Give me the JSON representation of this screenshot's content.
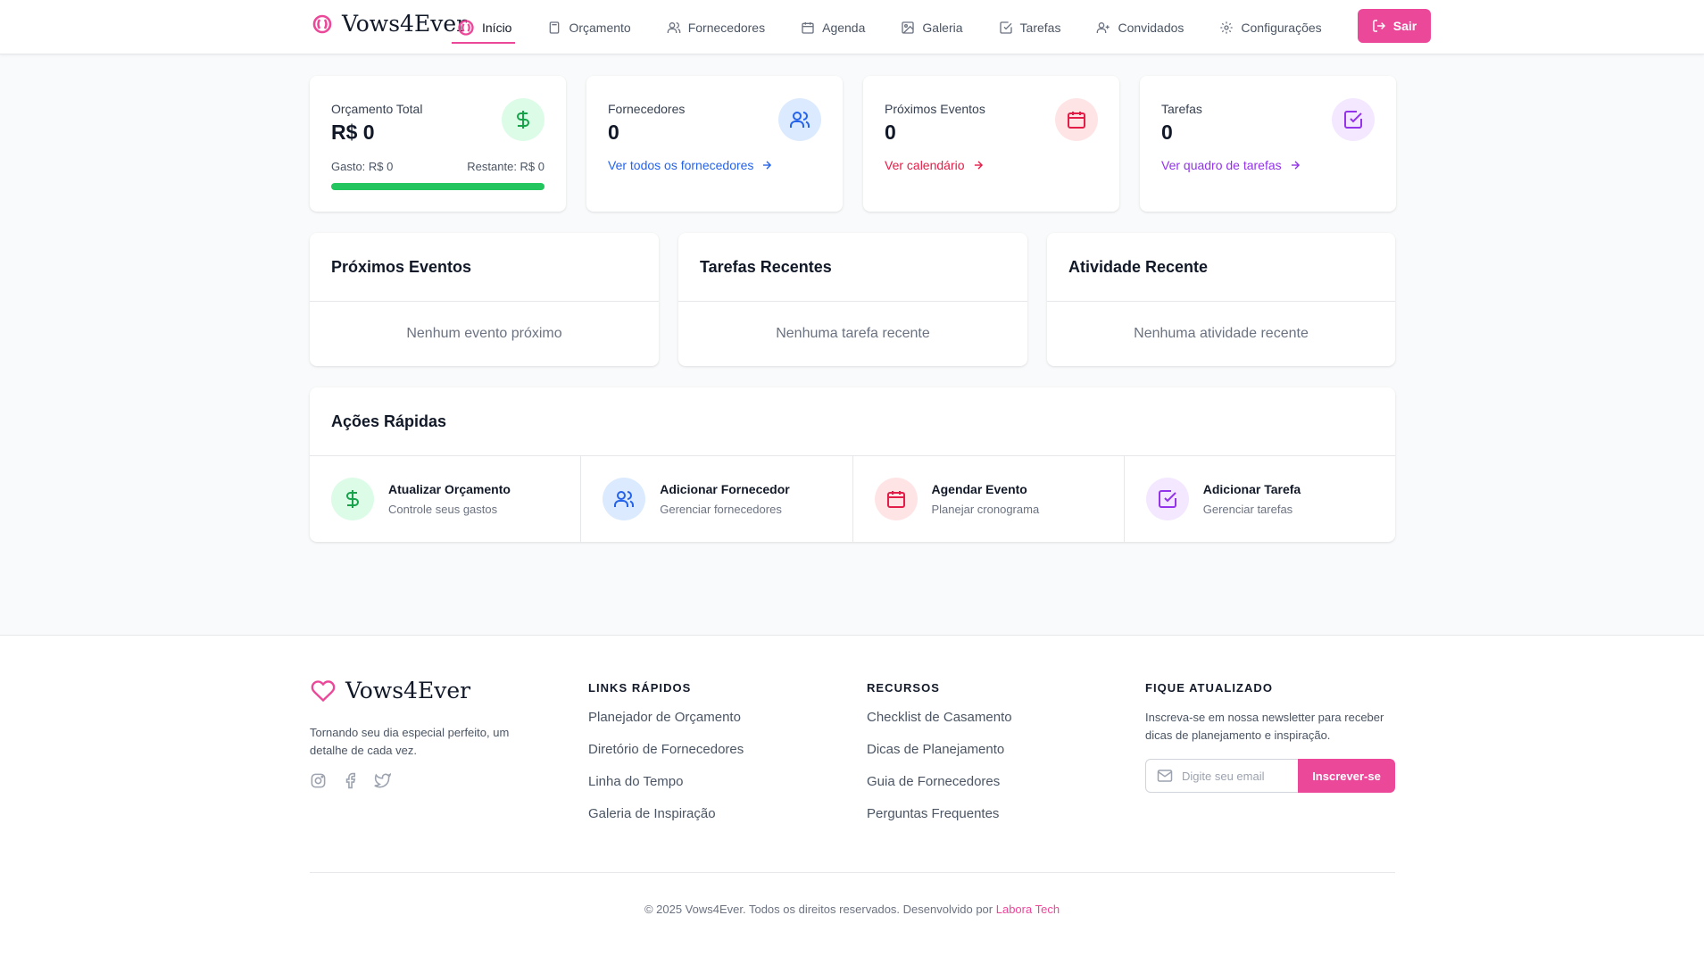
{
  "colors": {
    "accent": "#ec4899",
    "green": "#22c55e",
    "blue": "#2563eb",
    "red": "#e11d48",
    "purple": "#9333ea"
  },
  "nav": {
    "brand": "Vows4Ever",
    "links": [
      {
        "label": "Início",
        "icon": "rings-icon",
        "active": true
      },
      {
        "label": "Orçamento",
        "icon": "calculator-icon"
      },
      {
        "label": "Fornecedores",
        "icon": "users-icon"
      },
      {
        "label": "Agenda",
        "icon": "calendar-icon"
      },
      {
        "label": "Galeria",
        "icon": "image-icon"
      },
      {
        "label": "Tarefas",
        "icon": "checkbox-icon"
      },
      {
        "label": "Convidados",
        "icon": "user-plus-icon"
      },
      {
        "label": "Configurações",
        "icon": "gear-icon"
      }
    ],
    "logout": "Sair"
  },
  "stats": {
    "budget": {
      "label": "Orçamento Total",
      "value": "R$ 0",
      "spent": "Gasto: R$ 0",
      "remaining": "Restante: R$ 0",
      "progress": 1.0
    },
    "vendors": {
      "label": "Fornecedores",
      "value": "0",
      "link": "Ver todos os fornecedores"
    },
    "events": {
      "label": "Próximos Eventos",
      "value": "0",
      "link": "Ver calendário"
    },
    "tasks": {
      "label": "Tarefas",
      "value": "0",
      "link": "Ver quadro de tarefas"
    }
  },
  "panels": {
    "events": {
      "title": "Próximos Eventos",
      "empty": "Nenhum evento próximo"
    },
    "tasks": {
      "title": "Tarefas Recentes",
      "empty": "Nenhuma tarefa recente"
    },
    "activity": {
      "title": "Atividade Recente",
      "empty": "Nenhuma atividade recente"
    }
  },
  "quick_actions": {
    "title": "Ações Rápidas",
    "items": [
      {
        "title": "Atualizar Orçamento",
        "subtitle": "Controle seus gastos",
        "icon": "dollar-icon"
      },
      {
        "title": "Adicionar Fornecedor",
        "subtitle": "Gerenciar fornecedores",
        "icon": "users-icon"
      },
      {
        "title": "Agendar Evento",
        "subtitle": "Planejar cronograma",
        "icon": "calendar-icon"
      },
      {
        "title": "Adicionar Tarefa",
        "subtitle": "Gerenciar tarefas",
        "icon": "checkbox-icon"
      }
    ]
  },
  "footer": {
    "brand": "Vows4Ever",
    "tagline": "Tornando seu dia especial perfeito, um detalhe de cada vez.",
    "quick_links": {
      "title": "LINKS RÁPIDOS",
      "items": [
        "Planejador de Orçamento",
        "Diretório de Fornecedores",
        "Linha do Tempo",
        "Galeria de Inspiração"
      ]
    },
    "resources": {
      "title": "RECURSOS",
      "items": [
        "Checklist de Casamento",
        "Dicas de Planejamento",
        "Guia de Fornecedores",
        "Perguntas Frequentes"
      ]
    },
    "newsletter": {
      "title": "FIQUE ATUALIZADO",
      "text": "Inscreva-se em nossa newsletter para receber dicas de planejamento e inspiração.",
      "placeholder": "Digite seu email",
      "button": "Inscrever-se"
    },
    "copyright": "© 2025 Vows4Ever. Todos os direitos reservados. Desenvolvido por",
    "credit": "Labora Tech"
  }
}
